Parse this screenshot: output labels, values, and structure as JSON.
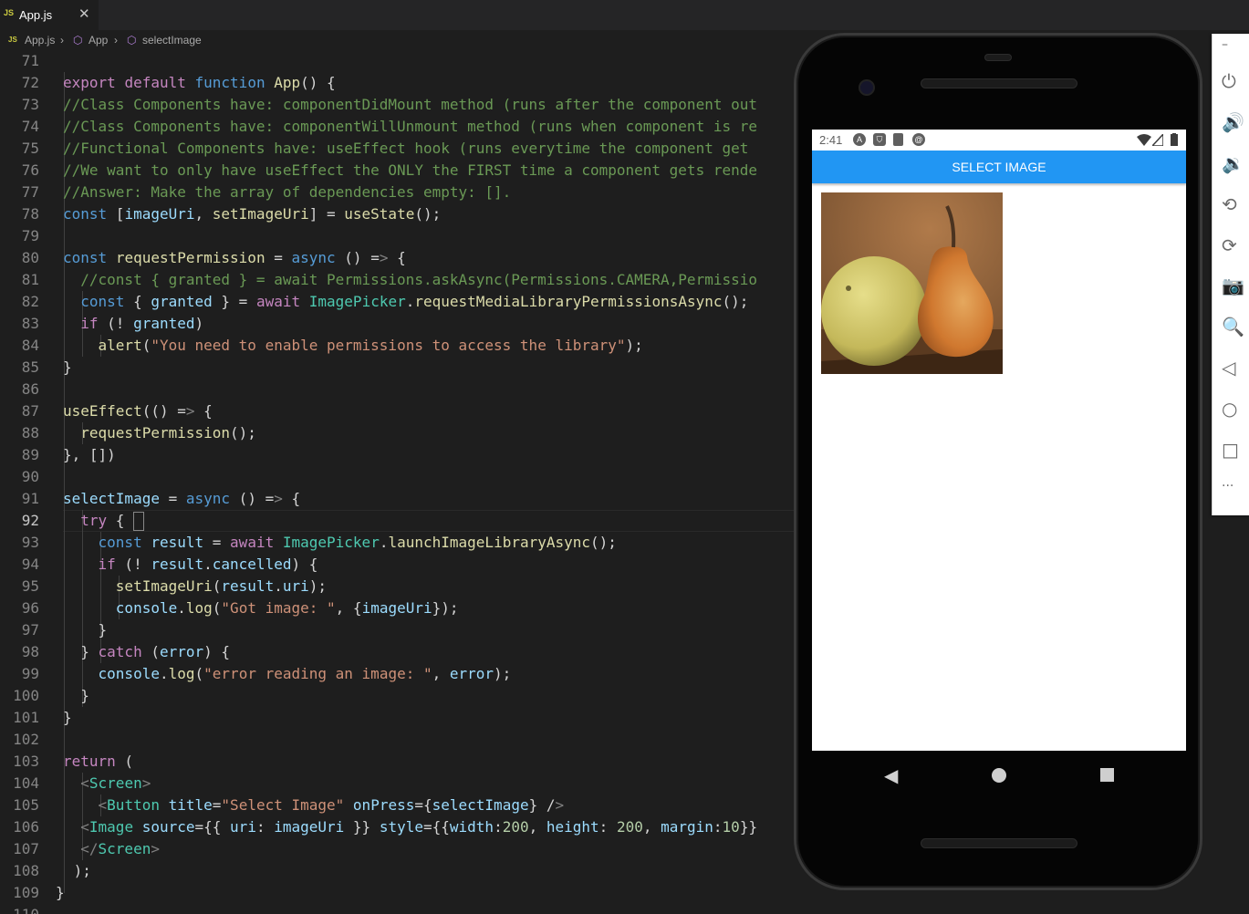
{
  "editor": {
    "tab": {
      "label": "App.js",
      "icon": "js-file-icon",
      "close": "✕"
    },
    "breadcrumb": [
      "App.js",
      "App",
      "selectImage"
    ],
    "current_line": "92"
  },
  "code_lines": [
    {
      "n": "71",
      "t": ""
    },
    {
      "n": "72",
      "t": "  export default function App() {"
    },
    {
      "n": "73",
      "t": "  //Class Components have: componentDidMount method (runs after the component out"
    },
    {
      "n": "74",
      "t": "  //Class Components have: componentWillUnmount method (runs when component is re"
    },
    {
      "n": "75",
      "t": "  //Functional Components have: useEffect hook (runs everytime the component get"
    },
    {
      "n": "76",
      "t": "  //We want to only have useEffect the ONLY the FIRST time a component gets rende"
    },
    {
      "n": "77",
      "t": "  //Answer: Make the array of dependencies empty: []."
    },
    {
      "n": "78",
      "t": "  const [imageUri, setImageUri] = useState();"
    },
    {
      "n": "79",
      "t": ""
    },
    {
      "n": "80",
      "t": "  const requestPermission = async () => {"
    },
    {
      "n": "81",
      "t": "    //const { granted } = await Permissions.askAsync(Permissions.CAMERA,Permissio"
    },
    {
      "n": "82",
      "t": "    const { granted } = await ImagePicker.requestMediaLibraryPermissionsAsync();"
    },
    {
      "n": "83",
      "t": "    if (! granted)"
    },
    {
      "n": "84",
      "t": "      alert(\"You need to enable permissions to access the library\");"
    },
    {
      "n": "85",
      "t": "  }"
    },
    {
      "n": "86",
      "t": ""
    },
    {
      "n": "87",
      "t": "  useEffect(() => {"
    },
    {
      "n": "88",
      "t": "    requestPermission();"
    },
    {
      "n": "89",
      "t": "  }, [])"
    },
    {
      "n": "90",
      "t": ""
    },
    {
      "n": "91",
      "t": "  selectImage = async () => {"
    },
    {
      "n": "92",
      "t": "    try {"
    },
    {
      "n": "93",
      "t": "      const result = await ImagePicker.launchImageLibraryAsync();"
    },
    {
      "n": "94",
      "t": "      if (! result.cancelled) {"
    },
    {
      "n": "95",
      "t": "        setImageUri(result.uri);"
    },
    {
      "n": "96",
      "t": "        console.log(\"Got image: \", {imageUri});"
    },
    {
      "n": "97",
      "t": "      }"
    },
    {
      "n": "98",
      "t": "    } catch (error) {"
    },
    {
      "n": "99",
      "t": "      console.log(\"error reading an image: \", error);"
    },
    {
      "n": "100",
      "t": "    }"
    },
    {
      "n": "101",
      "t": "  }"
    },
    {
      "n": "102",
      "t": ""
    },
    {
      "n": "103",
      "t": "  return ("
    },
    {
      "n": "104",
      "t": "    <Screen>"
    },
    {
      "n": "105",
      "t": "      <Button title=\"Select Image\" onPress={selectImage} />"
    },
    {
      "n": "106",
      "t": "    <Image source={{ uri: imageUri }} style={{width:200, height: 200, margin:10}}"
    },
    {
      "n": "107",
      "t": "    </Screen>"
    },
    {
      "n": "108",
      "t": " );"
    },
    {
      "n": "109",
      "t": "}"
    },
    {
      "n": "110",
      "t": ""
    }
  ],
  "phone": {
    "clock": "2:41",
    "status_icons": [
      "a-icon",
      "shield-icon",
      "sd-card-icon",
      "at-icon"
    ],
    "signal_icons": [
      "wifi-icon",
      "signal-icon",
      "battery-icon"
    ],
    "button_label": "SELECT IMAGE",
    "image": "pears-photo",
    "nav": [
      "back-icon",
      "home-icon",
      "recents-icon"
    ]
  },
  "emulator_toolbar": [
    {
      "name": "minimize-icon",
      "glyph": "–"
    },
    {
      "name": "power-icon",
      "glyph": "⏻"
    },
    {
      "name": "volume-up-icon",
      "glyph": "🔊"
    },
    {
      "name": "volume-down-icon",
      "glyph": "🔉"
    },
    {
      "name": "rotate-left-icon",
      "glyph": "⟲"
    },
    {
      "name": "rotate-right-icon",
      "glyph": "⟳"
    },
    {
      "name": "camera-icon",
      "glyph": "📷"
    },
    {
      "name": "zoom-icon",
      "glyph": "🔍"
    },
    {
      "name": "back-icon",
      "glyph": "◁"
    },
    {
      "name": "home-icon",
      "glyph": "○"
    },
    {
      "name": "overview-icon",
      "glyph": "□"
    },
    {
      "name": "more-icon",
      "glyph": "···"
    }
  ],
  "colors": {
    "editor_bg": "#1e1e1e",
    "accent": "#2196f3",
    "comment": "#6a9955",
    "keyword": "#c586c0"
  }
}
